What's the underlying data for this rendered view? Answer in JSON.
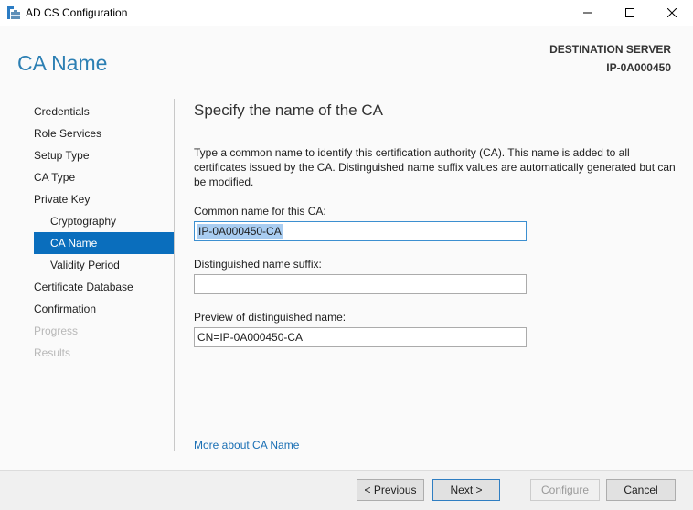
{
  "window": {
    "title": "AD CS Configuration",
    "icon": "server-toolbox-icon",
    "controls": [
      "minimize-icon",
      "maximize-icon",
      "close-icon"
    ]
  },
  "header": {
    "page_title": "CA Name",
    "destination_label": "DESTINATION SERVER",
    "destination_value": "IP-0A000450"
  },
  "nav": {
    "items": [
      {
        "label": "Credentials",
        "level": 0,
        "state": "normal"
      },
      {
        "label": "Role Services",
        "level": 0,
        "state": "normal"
      },
      {
        "label": "Setup Type",
        "level": 0,
        "state": "normal"
      },
      {
        "label": "CA Type",
        "level": 0,
        "state": "normal"
      },
      {
        "label": "Private Key",
        "level": 0,
        "state": "normal"
      },
      {
        "label": "Cryptography",
        "level": 1,
        "state": "normal"
      },
      {
        "label": "CA Name",
        "level": 1,
        "state": "active"
      },
      {
        "label": "Validity Period",
        "level": 1,
        "state": "normal"
      },
      {
        "label": "Certificate Database",
        "level": 0,
        "state": "normal"
      },
      {
        "label": "Confirmation",
        "level": 0,
        "state": "normal"
      },
      {
        "label": "Progress",
        "level": 0,
        "state": "disabled"
      },
      {
        "label": "Results",
        "level": 0,
        "state": "disabled"
      }
    ]
  },
  "main": {
    "heading": "Specify the name of the CA",
    "description": "Type a common name to identify this certification authority (CA). This name is added to all certificates issued by the CA. Distinguished name suffix values are automatically generated but can be modified.",
    "common_name_label": "Common name for this CA:",
    "common_name_value": "IP-0A000450-CA",
    "dn_suffix_label": "Distinguished name suffix:",
    "dn_suffix_value": "",
    "preview_label": "Preview of distinguished name:",
    "preview_value": "CN=IP-0A000450-CA",
    "more_link": "More about CA Name"
  },
  "footer": {
    "previous_label": "< Previous",
    "next_label": "Next >",
    "configure_label": "Configure",
    "cancel_label": "Cancel"
  },
  "colors": {
    "accent": "#0a6ebd",
    "title_blue": "#2c7fb3",
    "link": "#1a6fb4",
    "selection": "#a9cdf1"
  }
}
